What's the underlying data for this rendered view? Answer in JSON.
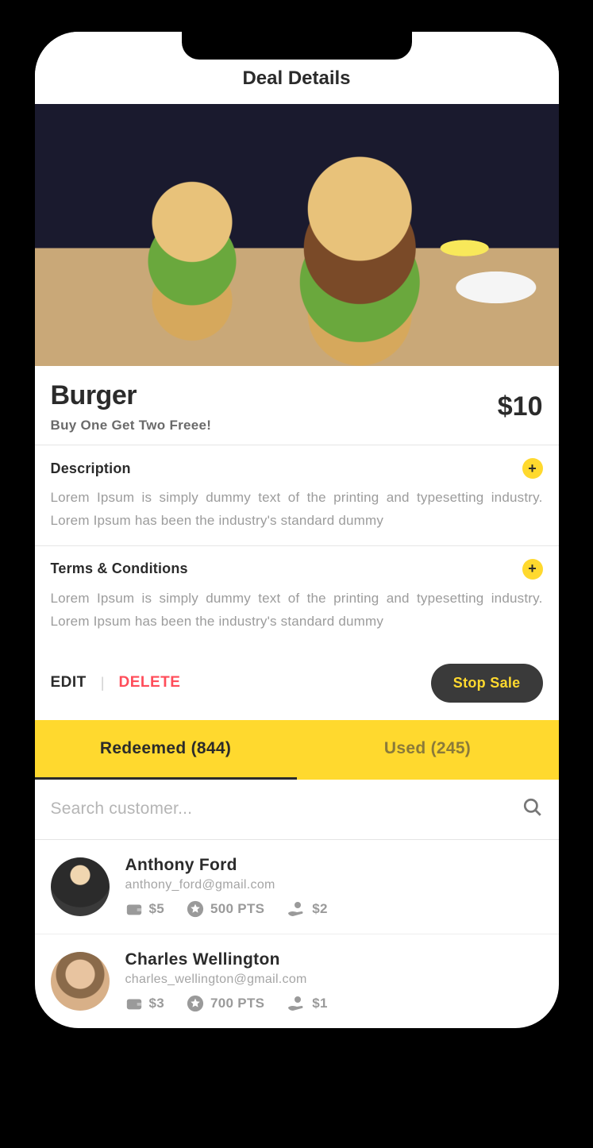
{
  "header": {
    "title": "Deal Details"
  },
  "deal": {
    "title": "Burger",
    "subtitle": "Buy One Get Two Freee!",
    "price": "$10"
  },
  "sections": {
    "description": {
      "title": "Description",
      "body": "Lorem Ipsum is simply dummy text of the printing and typesetting industry. Lorem Ipsum has been the industry's standard dummy"
    },
    "terms": {
      "title": "Terms & Conditions",
      "body": "Lorem Ipsum is simply dummy text of the printing and typesetting industry. Lorem Ipsum has been the industry's standard dummy"
    }
  },
  "actions": {
    "edit": "EDIT",
    "delete": "DELETE",
    "stop_sale": "Stop Sale"
  },
  "tabs": {
    "redeemed": "Redeemed (844)",
    "used": "Used (245)"
  },
  "search": {
    "placeholder": "Search customer..."
  },
  "customers": [
    {
      "name": "Anthony Ford",
      "email": "anthony_ford@gmail.com",
      "wallet": "$5",
      "points": "500 PTS",
      "tip": "$2"
    },
    {
      "name": "Charles Wellington",
      "email": "charles_wellington@gmail.com",
      "wallet": "$3",
      "points": "700 PTS",
      "tip": "$1"
    }
  ]
}
